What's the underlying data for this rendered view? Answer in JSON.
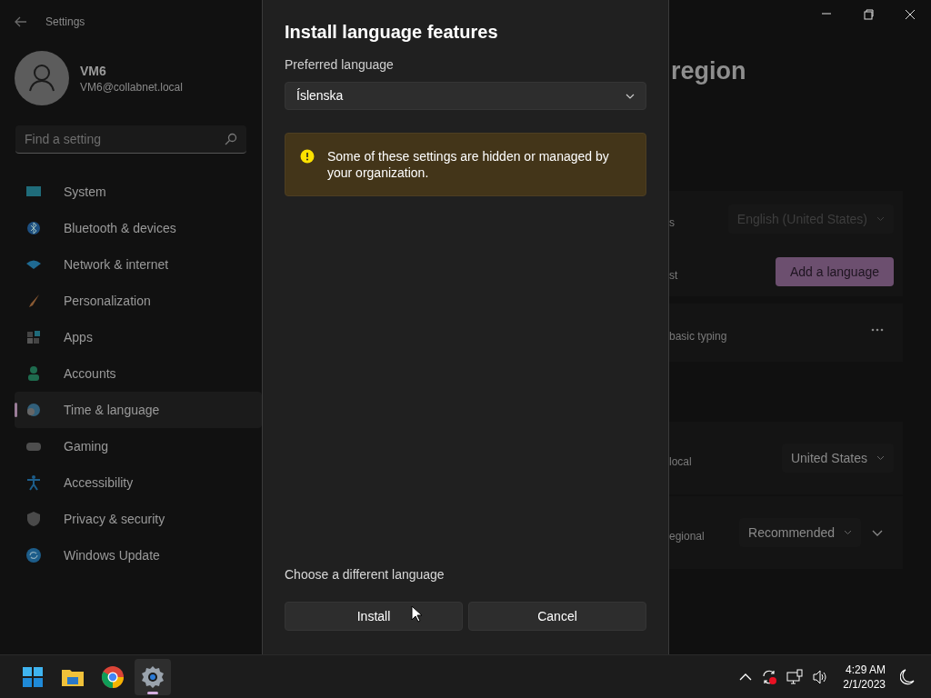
{
  "settings": {
    "title": "Settings",
    "user": {
      "name": "VM6",
      "email": "VM6@collabnet.local"
    },
    "search": {
      "placeholder": "Find a setting"
    },
    "nav": [
      {
        "label": "System",
        "selected": false
      },
      {
        "label": "Bluetooth & devices",
        "selected": false
      },
      {
        "label": "Network & internet",
        "selected": false
      },
      {
        "label": "Personalization",
        "selected": false
      },
      {
        "label": "Apps",
        "selected": false
      },
      {
        "label": "Accounts",
        "selected": false
      },
      {
        "label": "Time & language",
        "selected": true
      },
      {
        "label": "Gaming",
        "selected": false
      },
      {
        "label": "Accessibility",
        "selected": false
      },
      {
        "label": "Privacy & security",
        "selected": false
      },
      {
        "label": "Windows Update",
        "selected": false
      }
    ],
    "page_title": "region",
    "rows": [
      {
        "kind": "dropdown",
        "label": "s",
        "value": "English (United States)",
        "disabled": true,
        "expandable": false
      },
      {
        "kind": "button",
        "label": "st",
        "value": "Add a language"
      },
      {
        "kind": "more",
        "label": "basic typing"
      },
      {
        "kind": "dropdown",
        "label": "local",
        "value": "United States",
        "disabled": false,
        "expandable": false
      },
      {
        "kind": "dropdown",
        "label": "egional",
        "value": "Recommended",
        "disabled": false,
        "expandable": true
      }
    ]
  },
  "dialog": {
    "title": "Install language features",
    "field_label": "Preferred language",
    "select_value": "Íslenska",
    "warning": "Some of these settings are hidden or managed by your organization.",
    "link": "Choose a different language",
    "buttons": [
      "Install",
      "Cancel"
    ]
  },
  "taskbar": {
    "apps": [
      {
        "selected": false
      },
      {
        "selected": false
      },
      {
        "selected": false
      },
      {
        "selected": true
      }
    ],
    "time": "4:29 AM",
    "date": "2/1/2023"
  }
}
